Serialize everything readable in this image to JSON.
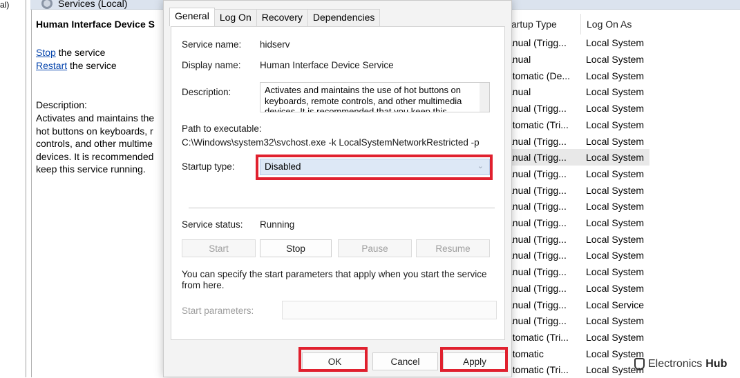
{
  "background": {
    "left_cut_text": "al)",
    "window_title": "Services (Local)",
    "selected_service_title": "Human Interface Device S",
    "stop_link": "Stop",
    "stop_suffix": " the service",
    "restart_link": "Restart",
    "restart_suffix": " the service",
    "description_label": "Description:",
    "description_text": "Activates and maintains the\nhot buttons on keyboards, r\ncontrols, and other multime\ndevices. It is recommended\nkeep this service running.",
    "columns": {
      "startup": "tartup Type",
      "logon": "Log On As"
    },
    "rows": [
      {
        "startup": "anual (Trigg...",
        "logon": "Local System"
      },
      {
        "startup": "anual",
        "logon": "Local System"
      },
      {
        "startup": "utomatic (De...",
        "logon": "Local System"
      },
      {
        "startup": "anual",
        "logon": "Local System"
      },
      {
        "startup": "anual (Trigg...",
        "logon": "Local System"
      },
      {
        "startup": "utomatic (Tri...",
        "logon": "Local System"
      },
      {
        "startup": "anual (Trigg...",
        "logon": "Local System"
      },
      {
        "startup": "anual (Trigg...",
        "logon": "Local System",
        "selected": true
      },
      {
        "startup": "anual (Trigg...",
        "logon": "Local System"
      },
      {
        "startup": "anual (Trigg...",
        "logon": "Local System"
      },
      {
        "startup": "anual (Trigg...",
        "logon": "Local System"
      },
      {
        "startup": "anual (Trigg...",
        "logon": "Local System"
      },
      {
        "startup": "anual (Trigg...",
        "logon": "Local System"
      },
      {
        "startup": "anual (Trigg...",
        "logon": "Local System"
      },
      {
        "startup": "anual (Trigg...",
        "logon": "Local System"
      },
      {
        "startup": "anual (Trigg...",
        "logon": "Local System"
      },
      {
        "startup": "anual (Trigg...",
        "logon": "Local Service"
      },
      {
        "startup": "anual (Trigg...",
        "logon": "Local System"
      },
      {
        "startup": "utomatic (Tri...",
        "logon": "Local System"
      },
      {
        "startup": "utomatic",
        "logon": "Local System"
      },
      {
        "startup": "utomatic (Tri...",
        "logon": "Local System"
      }
    ]
  },
  "dialog": {
    "tabs": [
      "General",
      "Log On",
      "Recovery",
      "Dependencies"
    ],
    "active_tab": "General",
    "service_name_label": "Service name:",
    "service_name": "hidserv",
    "display_name_label": "Display name:",
    "display_name": "Human Interface Device Service",
    "description_label": "Description:",
    "description": "Activates and maintains the use of hot buttons on keyboards, remote controls, and other multimedia devices. It is recommended that you keep this",
    "path_label": "Path to executable:",
    "path": "C:\\Windows\\system32\\svchost.exe -k LocalSystemNetworkRestricted -p",
    "startup_type_label": "Startup type:",
    "startup_type": "Disabled",
    "status_label": "Service status:",
    "status": "Running",
    "buttons": {
      "start": "Start",
      "stop": "Stop",
      "pause": "Pause",
      "resume": "Resume"
    },
    "params_hint": "You can specify the start parameters that apply when you start the service from here.",
    "params_label": "Start parameters:",
    "params_value": "",
    "footer": {
      "ok": "OK",
      "cancel": "Cancel",
      "apply": "Apply"
    }
  },
  "highlight_color": "#e0202e",
  "watermark": {
    "brand": "Electronics",
    "suffix": "Hub"
  }
}
